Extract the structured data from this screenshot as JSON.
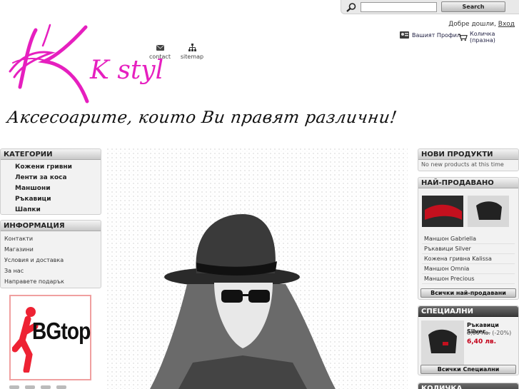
{
  "search": {
    "placeholder": "",
    "value": "",
    "button_label": "Search"
  },
  "header": {
    "welcome": "Добре дошли,",
    "login": "Вход",
    "profile": "Вашият Профил",
    "cart": "Количка (празна)",
    "nav": {
      "contact": "contact",
      "sitemap": "sitemap"
    },
    "logo_text": "K style",
    "slogan": "Аксесоарите, които Ви правят различни!"
  },
  "left": {
    "categories": {
      "title": "КАТЕГОРИИ",
      "items": [
        "Кожени гривни",
        "Ленти за коса",
        "Маншони",
        "Ръкавици",
        "Шапки"
      ]
    },
    "information": {
      "title": "ИНФОРМАЦИЯ",
      "items": [
        "Контакти",
        "Магазини",
        "Условия и доставка",
        "За нас",
        "Направете подарък"
      ]
    },
    "badge_text": "BGtop"
  },
  "right": {
    "new_products": {
      "title": "НОВИ ПРОДУКТИ",
      "empty": "No new products at this time"
    },
    "best_sellers": {
      "title": "НАЙ-ПРОДАВАНО",
      "items": [
        "Маншон Gabriella",
        "Ръкавици Silver",
        "Кожена гривна Kalissa",
        "Маншон Omnia",
        "Маншон Precious"
      ],
      "all_button": "Всички най-продавани"
    },
    "specials": {
      "title": "СПЕЦИАЛНИ",
      "product_name": "Ръкавици Silver",
      "old_price": "8,00 лв.",
      "discount": "(-20%)",
      "new_price": "6,40 лв.",
      "all_button": "Всички Специални"
    },
    "cart_box": {
      "title": "КОЛИЧКА"
    }
  }
}
